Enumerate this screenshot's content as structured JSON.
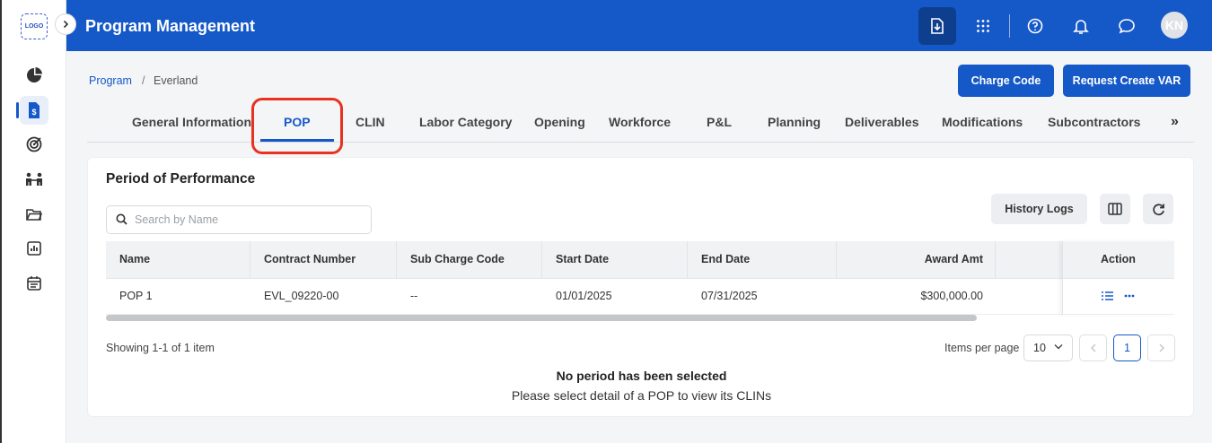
{
  "app": {
    "title": "Program Management",
    "logo_text": "LOGO",
    "avatar_initials": "KN"
  },
  "sidebar": {
    "items": [
      "dashboard-icon",
      "finance-icon",
      "target-icon",
      "team-icon",
      "folder-icon",
      "report-icon",
      "calendar-icon"
    ],
    "active": "finance-icon"
  },
  "topbar": {
    "icons": [
      "download-icon",
      "apps-grid-icon",
      "help-icon",
      "bell-icon",
      "chat-icon"
    ]
  },
  "breadcrumb": {
    "root": "Program",
    "separator": "/",
    "current": "Everland"
  },
  "actions": {
    "charge_code": "Charge Code",
    "request_var": "Request Create VAR"
  },
  "tabs": [
    {
      "label": "General Information"
    },
    {
      "label": "POP",
      "active": true
    },
    {
      "label": "CLIN"
    },
    {
      "label": "Labor Category"
    },
    {
      "label": "Opening"
    },
    {
      "label": "Workforce"
    },
    {
      "label": "P&L"
    },
    {
      "label": "Planning"
    },
    {
      "label": "Deliverables"
    },
    {
      "label": "Modifications"
    },
    {
      "label": "Subcontractors"
    }
  ],
  "tabs_more": "»",
  "section": {
    "title": "Period of Performance",
    "search_placeholder": "Search by Name",
    "history_logs": "History Logs"
  },
  "table": {
    "headers": {
      "name": "Name",
      "contract": "Contract Number",
      "sub_charge": "Sub Charge Code",
      "start": "Start Date",
      "end": "End Date",
      "award": "Award Amt",
      "action": "Action"
    },
    "rows": [
      {
        "name": "POP 1",
        "contract": "EVL_09220-00",
        "sub_charge": "--",
        "start": "01/01/2025",
        "end": "07/31/2025",
        "award": "$300,000.00"
      }
    ]
  },
  "pagination": {
    "showing": "Showing 1-1 of 1 item",
    "items_per_page_label": "Items per page",
    "items_per_page": "10",
    "current_page": "1"
  },
  "empty_state": {
    "title": "No period has been selected",
    "subtitle": "Please select detail of a POP to view its CLINs"
  },
  "colors": {
    "primary": "#1558c7",
    "highlight": "#e8321f"
  }
}
